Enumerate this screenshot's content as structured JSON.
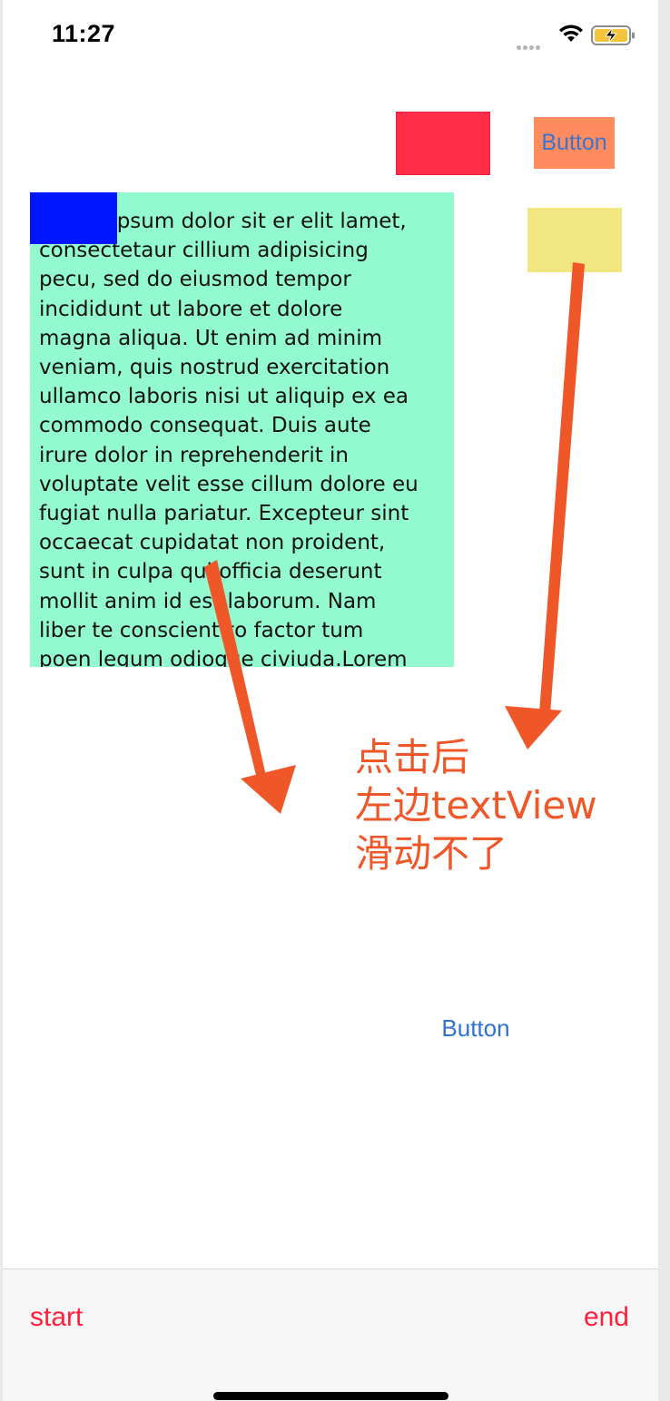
{
  "status_bar": {
    "time": "11:27",
    "signal_icon": "cellular-dots-icon",
    "wifi_icon": "wifi-icon",
    "battery_icon": "battery-charging-icon"
  },
  "top_button": {
    "label": "Button",
    "background": "#ff8c5e",
    "text_color": "#3b73d1"
  },
  "colored_blocks": {
    "red": "#ff2d47",
    "yellow": "#f1e680",
    "blue": "#0016ff",
    "text_view_background": "#93f9cf"
  },
  "text_view": {
    "content": "Lorem ipsum dolor sit er elit lamet,\nconsectetaur cillium adipisicing\npecu, sed do eiusmod tempor\nincididunt ut labore et dolore\nmagna aliqua. Ut enim ad minim\nveniam, quis nostrud exercitation\nullamco laboris nisi ut aliquip ex ea\ncommodo consequat. Duis aute\nirure dolor in reprehenderit in\nvoluptate velit esse cillum dolore eu\nfugiat nulla pariatur. Excepteur sint\noccaecat cupidatat non proident,\nsunt in culpa qui officia deserunt\nmollit anim id est laborum. Nam\nliber te conscient to factor tum\npoen legum odioque civiuda.Lorem"
  },
  "annotation": {
    "lines": [
      "点击后",
      "左边textView",
      "滑动不了"
    ],
    "color": "#ef5628"
  },
  "middle_button": {
    "label": "Button"
  },
  "toolbar": {
    "start_label": "start",
    "end_label": "end",
    "tint": "#ff1f3d"
  }
}
